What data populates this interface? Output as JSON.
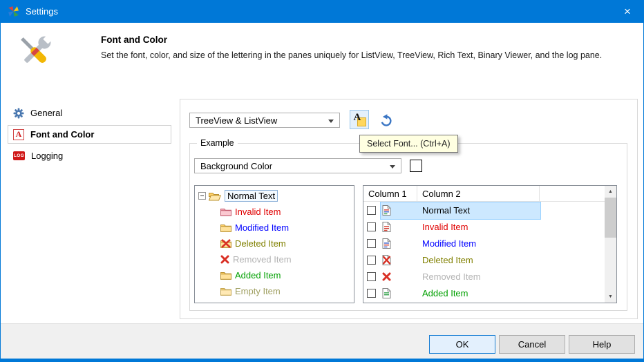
{
  "window": {
    "title": "Settings",
    "close_glyph": "×"
  },
  "header": {
    "title": "Font and Color",
    "description": "Set the font, color, and size of the lettering in the panes uniquely for ListView, TreeView, Rich Text, Binary Viewer, and the log pane."
  },
  "sidebar": {
    "items": [
      {
        "label": "General",
        "icon": "gear-icon",
        "selected": false
      },
      {
        "label": "Font and Color",
        "icon": "font-a-icon",
        "icon_glyph": "A",
        "selected": true
      },
      {
        "label": "Logging",
        "icon": "log-icon",
        "icon_glyph": "LOG",
        "selected": false
      }
    ]
  },
  "panel": {
    "pane_dropdown": {
      "value": "TreeView & ListView"
    },
    "font_button": {
      "glyph": "A",
      "icon": "select-font-icon"
    },
    "undo_button": {
      "icon": "undo-icon"
    },
    "tooltip": {
      "text": "Select Font... (Ctrl+A)"
    },
    "example": {
      "label": "Example",
      "color_dropdown": {
        "value": "Background Color"
      },
      "swatch_color": "#ffffff",
      "tree": {
        "items": [
          {
            "label": "Normal Text",
            "color": "#000000",
            "icon": "open-folder-icon",
            "selected": true
          },
          {
            "label": "Invalid Item",
            "color": "#e00000",
            "icon": "invalid-folder-icon",
            "selected": false
          },
          {
            "label": "Modified Item",
            "color": "#0000ff",
            "icon": "folder-icon",
            "selected": false
          },
          {
            "label": "Deleted Item",
            "color": "#808000",
            "icon": "deleted-folder-icon",
            "selected": false
          },
          {
            "label": "Removed Item",
            "color": "#b4b4b4",
            "icon": "red-x-icon",
            "selected": false
          },
          {
            "label": "Added Item",
            "color": "#00a000",
            "icon": "folder-icon",
            "selected": false
          },
          {
            "label": "Empty Item",
            "color": "#9f9f60",
            "icon": "folder-icon",
            "selected": false
          }
        ]
      },
      "list": {
        "columns": [
          {
            "label": "Column 1"
          },
          {
            "label": "Column 2"
          }
        ],
        "rows": [
          {
            "label": "Normal Text",
            "color": "#000000",
            "icon": "file-icon",
            "checked": false,
            "selected": true
          },
          {
            "label": "Invalid Item",
            "color": "#e00000",
            "icon": "file-icon",
            "checked": false,
            "selected": false
          },
          {
            "label": "Modified Item",
            "color": "#0000ff",
            "icon": "file-icon",
            "checked": false,
            "selected": false
          },
          {
            "label": "Deleted Item",
            "color": "#808000",
            "icon": "deleted-file-icon",
            "checked": false,
            "selected": false
          },
          {
            "label": "Removed Item",
            "color": "#b4b4b4",
            "icon": "red-x-icon",
            "checked": false,
            "selected": false
          },
          {
            "label": "Added Item",
            "color": "#00a000",
            "icon": "file-icon",
            "checked": false,
            "selected": false
          }
        ]
      }
    }
  },
  "footer": {
    "ok_label": "OK",
    "cancel_label": "Cancel",
    "help_label": "Help"
  },
  "colors": {
    "titlebar": "#0078d7",
    "selection_bg": "#cce8ff",
    "selection_border": "#99d1ff",
    "tooltip_bg": "#ffffe1"
  }
}
